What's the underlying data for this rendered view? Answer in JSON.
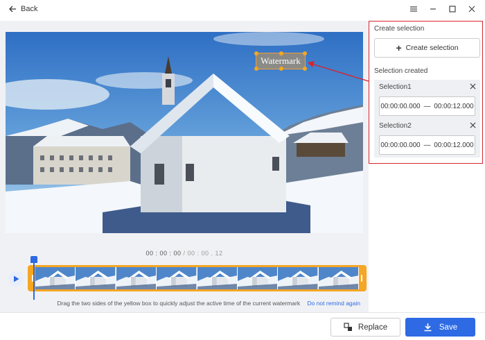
{
  "titlebar": {
    "back_label": "Back"
  },
  "preview": {
    "watermark_text": "Watermark"
  },
  "timeline": {
    "current_time": "00 : 00 : 00",
    "separator": " / ",
    "total_time": "00 : 00 . 12",
    "hint_text": "Drag the two sides of the yellow box to quickly adjust the active time of the current watermark",
    "hint_link": "Do not remind again",
    "frame_count": 8
  },
  "panel": {
    "create_title": "Create selection",
    "create_button": "Create selection",
    "created_title": "Selection created",
    "selections": [
      {
        "name": "Selection1",
        "start": "00:00:00.000",
        "dash": "—",
        "end": "00:00:12.000"
      },
      {
        "name": "Selection2",
        "start": "00:00:00.000",
        "dash": "—",
        "end": "00:00:12.000"
      }
    ]
  },
  "footer": {
    "replace_label": "Replace",
    "save_label": "Save"
  },
  "colors": {
    "accent": "#2d6ae3",
    "timeline_border": "#f5a623",
    "highlight": "#d9232e"
  }
}
